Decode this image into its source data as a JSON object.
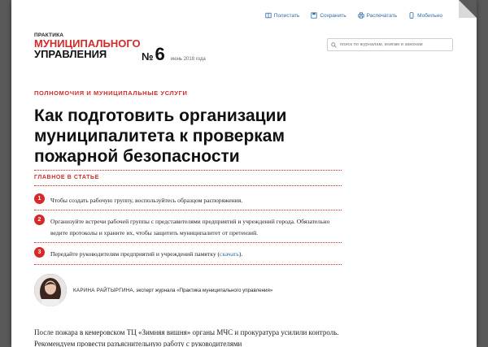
{
  "toolbar": {
    "items": [
      {
        "label": "Полистать",
        "icon": "book-icon"
      },
      {
        "label": "Сохранить",
        "icon": "save-icon"
      },
      {
        "label": "Распечатать",
        "icon": "print-icon"
      },
      {
        "label": "Мобильно",
        "icon": "mobile-icon"
      }
    ]
  },
  "logo": {
    "line1": "ПРАКТИКА",
    "line2": "МУНИЦИПАЛЬНОГО",
    "line3": "УПРАВЛЕНИЯ"
  },
  "issue": {
    "no_sign": "№",
    "number": "6",
    "date": "июнь 2018 года"
  },
  "search": {
    "placeholder": "поиск по журналам, книгам и законам"
  },
  "article": {
    "category": "ПОЛНОМОЧИЯ И МУНИЦИПАЛЬНЫЕ УСЛУГИ",
    "title": "Как подготовить организации муниципалитета к проверкам пожарной безопасности",
    "main_label": "ГЛАВНОЕ В СТАТЬЕ",
    "points": [
      {
        "num": "1",
        "text": "Чтобы создать рабочую группу, воспользуйтесь образцом распоряжения."
      },
      {
        "num": "2",
        "text": "Организуйте встречи рабочей группы с представителями предприятий и учреждений города. Обязательно ведите протоколы и храните их, чтобы защитить муниципалитет от претензий."
      },
      {
        "num": "3",
        "text_before": "Передайте руководителям предприятий и учреждений памятку (",
        "link": "скачать",
        "text_after": ")."
      }
    ],
    "author": {
      "name": "КАРИНА РАЙТЫРГИНА",
      "role": ", эксперт журнала «Практика муниципального управления»"
    },
    "body": "После пожара в кемеровском ТЦ «Зимняя вишня» органы МЧС и прокуратура усилили контроль. Рекомендуем провести разъяснительную работу с руководителями"
  },
  "colors": {
    "accent": "#d42a2a",
    "link": "#2f6aa8",
    "backdrop": "#5a5a5a"
  }
}
